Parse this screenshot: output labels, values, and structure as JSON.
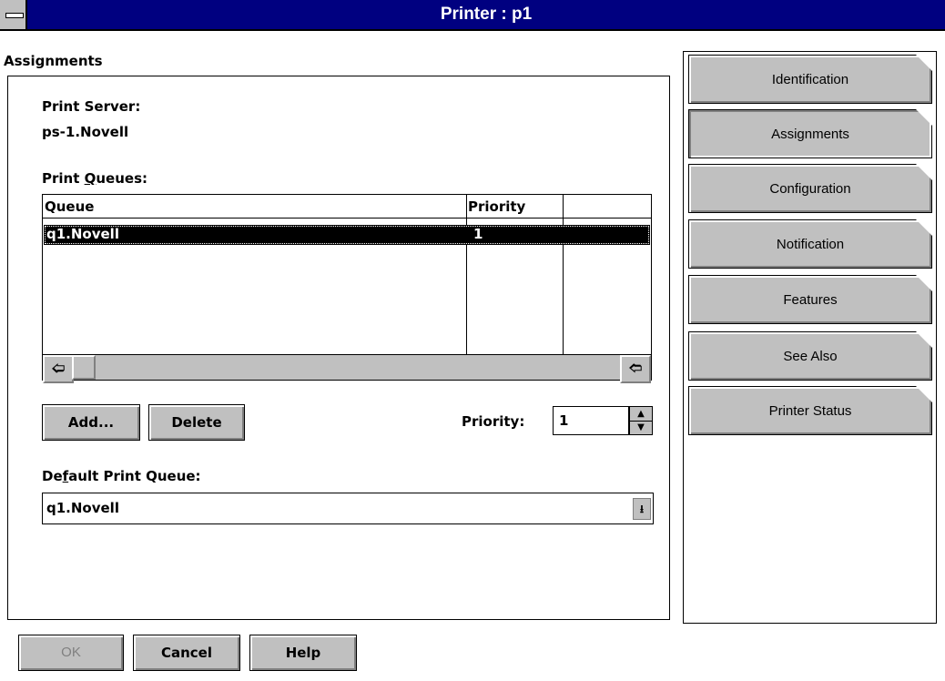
{
  "window": {
    "title": "Printer : p1"
  },
  "section": {
    "title": "Assignments"
  },
  "print_server": {
    "label": "Print Server:",
    "value": "ps-1.Novell"
  },
  "print_queues": {
    "label": "Print Queues:",
    "columns": [
      "Queue",
      "Priority"
    ],
    "rows": [
      {
        "queue": "q1.Novell",
        "priority": "1"
      }
    ]
  },
  "buttons": {
    "add": "Add...",
    "delete": "Delete",
    "ok": "OK",
    "cancel": "Cancel",
    "help": "Help"
  },
  "priority": {
    "label": "Priority:",
    "value": "1"
  },
  "default_queue": {
    "label": "Default Print Queue:",
    "value": "q1.Novell"
  },
  "tabs": [
    {
      "label": "Identification",
      "active": false
    },
    {
      "label": "Assignments",
      "active": true
    },
    {
      "label": "Configuration",
      "active": false
    },
    {
      "label": "Notification",
      "active": false
    },
    {
      "label": "Features",
      "active": false
    },
    {
      "label": "See Also",
      "active": false
    },
    {
      "label": "Printer Status",
      "active": false
    }
  ]
}
